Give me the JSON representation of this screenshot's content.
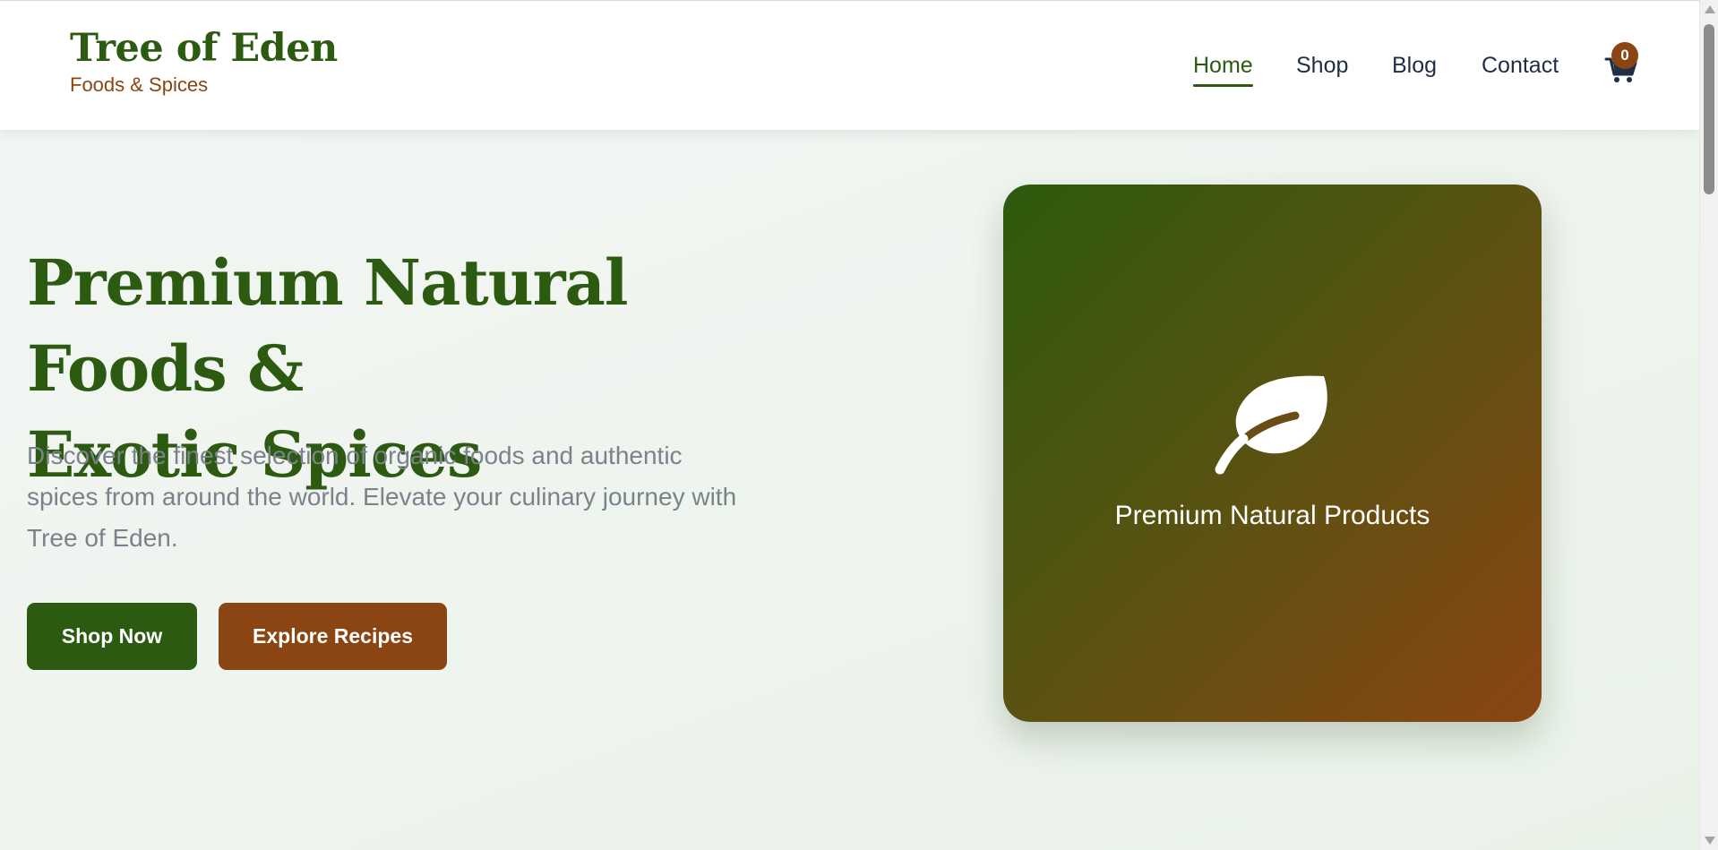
{
  "brand": {
    "name": "Tree of Eden",
    "tagline": "Foods & Spices",
    "primary_color": "#2d5a11",
    "accent_color": "#8b4513"
  },
  "nav": {
    "items": [
      {
        "label": "Home",
        "active": true
      },
      {
        "label": "Shop",
        "active": false
      },
      {
        "label": "Blog",
        "active": false
      },
      {
        "label": "Contact",
        "active": false
      }
    ],
    "cart": {
      "icon": "cart-icon",
      "count": "0"
    }
  },
  "hero": {
    "title_line1": "Premium Natural Foods &",
    "title_line2": "Exotic Spices",
    "description_line1": "Discover the finest selection of organic foods and authentic",
    "description_line2": "spices from around the world. Elevate your culinary journey with",
    "description_line3": "Tree of Eden.",
    "primary_button": "Shop Now",
    "secondary_button": "Explore Recipes"
  },
  "feature_card": {
    "icon": "leaf-icon",
    "label": "Premium Natural Products"
  }
}
